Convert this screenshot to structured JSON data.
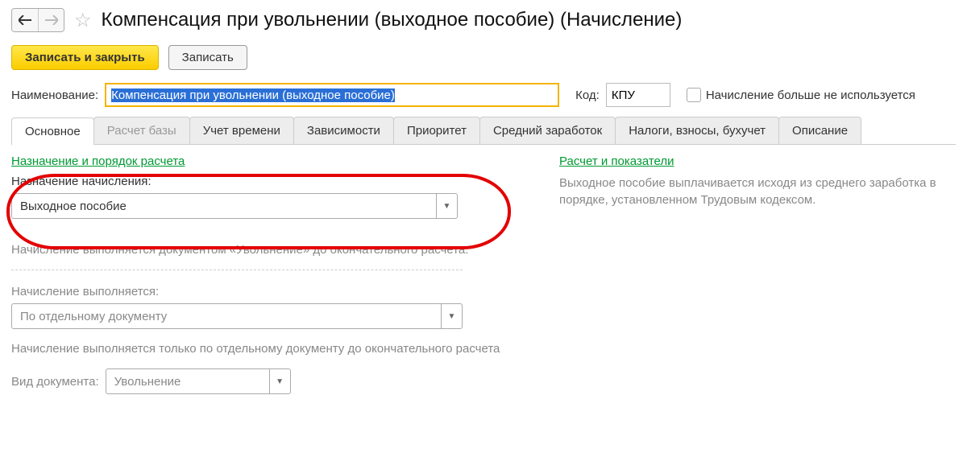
{
  "header": {
    "title": "Компенсация при увольнении (выходное пособие) (Начисление)"
  },
  "actions": {
    "save_close": "Записать и закрыть",
    "save": "Записать"
  },
  "fields": {
    "name_label": "Наименование:",
    "name_value": "Компенсация при увольнении (выходное пособие)",
    "code_label": "Код:",
    "code_value": "КПУ",
    "not_used_label": "Начисление больше не используется"
  },
  "tabs": [
    "Основное",
    "Расчет базы",
    "Учет времени",
    "Зависимости",
    "Приоритет",
    "Средний заработок",
    "Налоги, взносы, бухучет",
    "Описание"
  ],
  "main": {
    "section_purpose_title": "Назначение и порядок расчета",
    "purpose_label": "Назначение начисления:",
    "purpose_value": "Выходное пособие",
    "purpose_note": "Начисление выполняется документом «Увольнение» до окончательного расчета.",
    "exec_label": "Начисление выполняется:",
    "exec_value": "По отдельному документу",
    "exec_note": "Начисление выполняется только по отдельному документу до окончательного расчета",
    "doc_type_label": "Вид документа:",
    "doc_type_value": "Увольнение"
  },
  "right": {
    "title": "Расчет и показатели",
    "text": "Выходное пособие выплачивается исходя из среднего заработка в порядке, установленном Трудовым кодексом."
  }
}
